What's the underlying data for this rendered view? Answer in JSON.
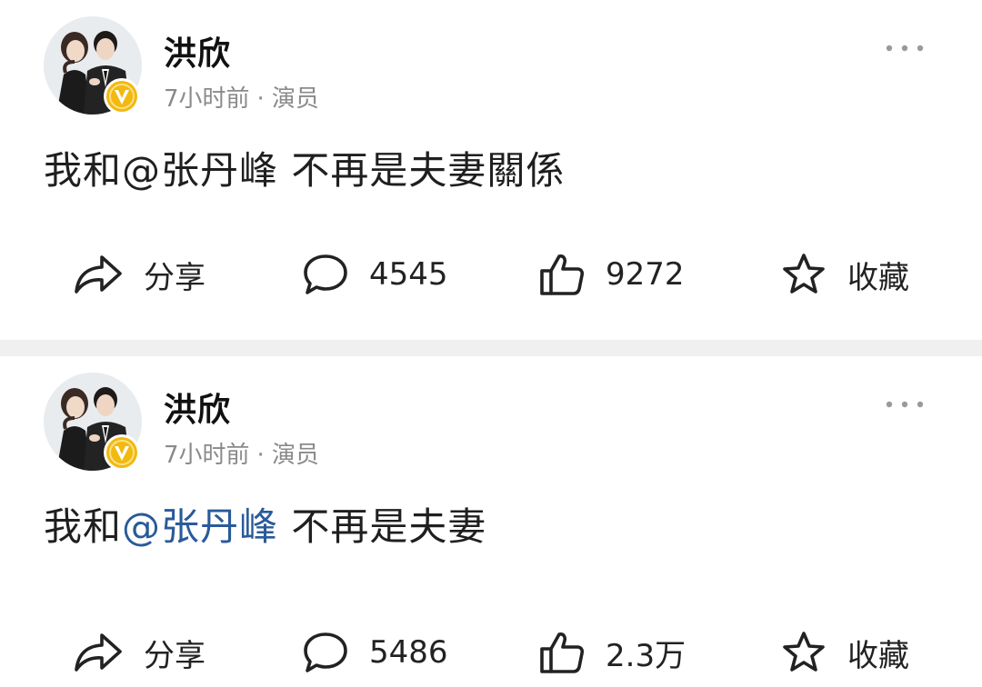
{
  "feed": {
    "posts": [
      {
        "author": "洪欣",
        "time": "7小时前",
        "separator": "·",
        "label": "演员",
        "text_prefix": "我和",
        "mention": "@张丹峰",
        "text_suffix": " 不再是夫妻關係",
        "actions": {
          "share": "分享",
          "comments": "4545",
          "likes": "9272",
          "favorite": "收藏"
        }
      },
      {
        "author": "洪欣",
        "time": "7小时前",
        "separator": "·",
        "label": "演员",
        "text_prefix": "我和",
        "mention": "@张丹峰",
        "text_suffix": " 不再是夫妻",
        "actions": {
          "share": "分享",
          "comments": "5486",
          "likes": "2.3万",
          "favorite": "收藏"
        }
      }
    ]
  },
  "colors": {
    "mention_link": "#2a5a9a",
    "verified_badge": "#f2b90f",
    "divider": "#f0f0f0",
    "meta_text": "#8a8a8a"
  },
  "icons": {
    "share": "share-arrow-icon",
    "comment": "comment-bubble-icon",
    "like": "thumbs-up-icon",
    "favorite": "star-icon",
    "more": "more-dots-icon",
    "verified": "verified-v-badge-icon"
  }
}
